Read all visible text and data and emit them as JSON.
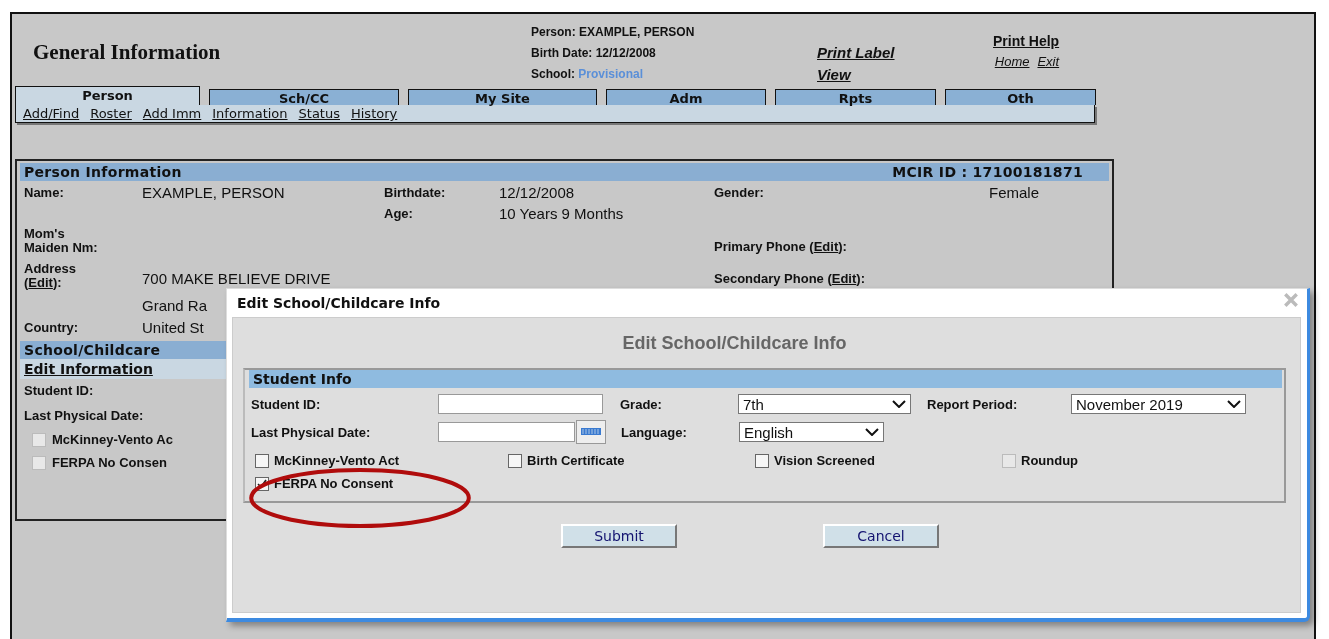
{
  "header": {
    "title": "General Information",
    "person_label": "Person:",
    "person_value": "EXAMPLE, PERSON",
    "birth_label": "Birth Date:",
    "birth_value": "12/12/2008",
    "school_label": "School:",
    "school_value": "Provisional",
    "print_label_link": "Print Label View",
    "print_help_link": "Print Help",
    "home_link": "Home",
    "exit_link": "Exit"
  },
  "tabs": [
    {
      "label": "Person",
      "selected": true
    },
    {
      "label": "Sch/CC",
      "selected": false
    },
    {
      "label": "My Site",
      "selected": false
    },
    {
      "label": "Adm",
      "selected": false
    },
    {
      "label": "Rpts",
      "selected": false
    },
    {
      "label": "Oth",
      "selected": false
    }
  ],
  "subnav": [
    "Add/Find",
    "Roster",
    "Add Imm",
    "Information",
    "Status",
    "History"
  ],
  "person_panel": {
    "title": "Person Information",
    "mcir_id": "MCIR ID : 17100181871",
    "name_label": "Name:",
    "name_value": "EXAMPLE, PERSON",
    "birthdate_label": "Birthdate:",
    "birthdate_value": "12/12/2008",
    "gender_label": "Gender:",
    "gender_value": "Female",
    "age_label": "Age:",
    "age_value": "10 Years 9 Months",
    "maiden_label": "Mom's Maiden Nm:",
    "primary_phone_label": "Primary Phone (",
    "primary_phone_edit": "Edit",
    "primary_phone_end": "):",
    "address_label": "Address",
    "address_edit_open": "(",
    "address_edit": "Edit",
    "address_edit_close": "):",
    "address_value": "700 MAKE BELIEVE DRIVE",
    "secondary_phone_label": "Secondary Phone (",
    "secondary_phone_edit": "Edit",
    "secondary_phone_end": "):",
    "city_value": "Grand Ra",
    "country_label": "Country:",
    "country_value": "United St"
  },
  "school_panel": {
    "title": "School/Childcare",
    "edit_link": "Edit Information",
    "student_id_label": "Student ID:",
    "physical_label": "Last Physical Date:",
    "checkboxes": [
      {
        "label": "McKinney-Vento Ac",
        "checked": false
      },
      {
        "label": "FERPA No Consen",
        "checked": false
      }
    ]
  },
  "dialog": {
    "title": "Edit School/Childcare Info",
    "heading": "Edit School/Childcare Info",
    "section_title": "Student Info",
    "student_id_label": "Student ID:",
    "grade_label": "Grade:",
    "grade_value": "7th",
    "report_period_label": "Report Period:",
    "report_period_value": "November 2019",
    "physical_label": "Last Physical Date:",
    "language_label": "Language:",
    "language_value": "English",
    "checkboxes": [
      {
        "label": "McKinney-Vento Act",
        "checked": false,
        "disabled": false
      },
      {
        "label": "Birth Certificate",
        "checked": false,
        "disabled": false
      },
      {
        "label": "Vision Screened",
        "checked": false,
        "disabled": false
      },
      {
        "label": "Roundup",
        "checked": false,
        "disabled": true
      },
      {
        "label": "FERPA No Consent",
        "checked": true,
        "disabled": false
      }
    ],
    "buttons": [
      "Submit",
      "Cancel"
    ]
  }
}
